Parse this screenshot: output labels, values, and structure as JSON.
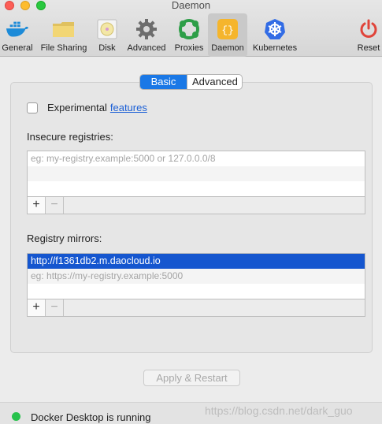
{
  "window": {
    "title": "Daemon"
  },
  "toolbar": {
    "items": [
      {
        "label": "General",
        "icon": "docker-whale-icon"
      },
      {
        "label": "File Sharing",
        "icon": "folder-icon"
      },
      {
        "label": "Disk",
        "icon": "disk-icon"
      },
      {
        "label": "Advanced",
        "icon": "gear-icon"
      },
      {
        "label": "Proxies",
        "icon": "proxies-icon"
      },
      {
        "label": "Daemon",
        "icon": "daemon-braces-icon"
      },
      {
        "label": "Kubernetes",
        "icon": "kubernetes-helm-icon"
      },
      {
        "label": "Reset",
        "icon": "power-icon"
      }
    ],
    "selected": "Daemon"
  },
  "segmented": {
    "basic": "Basic",
    "advanced": "Advanced",
    "active": "Basic"
  },
  "experimental": {
    "label": "Experimental",
    "link": "features",
    "checked": false
  },
  "insecure": {
    "label": "Insecure registries:",
    "placeholder": "eg: my-registry.example:5000 or 127.0.0.0/8",
    "add": "+",
    "remove": "−"
  },
  "mirrors": {
    "label": "Registry mirrors:",
    "entry": "http://f1361db2.m.daocloud.io",
    "placeholder": "eg: https://my-registry.example:5000",
    "add": "+",
    "remove": "−"
  },
  "apply_button": "Apply & Restart",
  "status": {
    "text": "Docker Desktop is running",
    "color": "#27c24c"
  },
  "watermark": "https://blog.csdn.net/dark_guo",
  "colors": {
    "accent": "#1a78e6",
    "selection": "#1556cf"
  }
}
